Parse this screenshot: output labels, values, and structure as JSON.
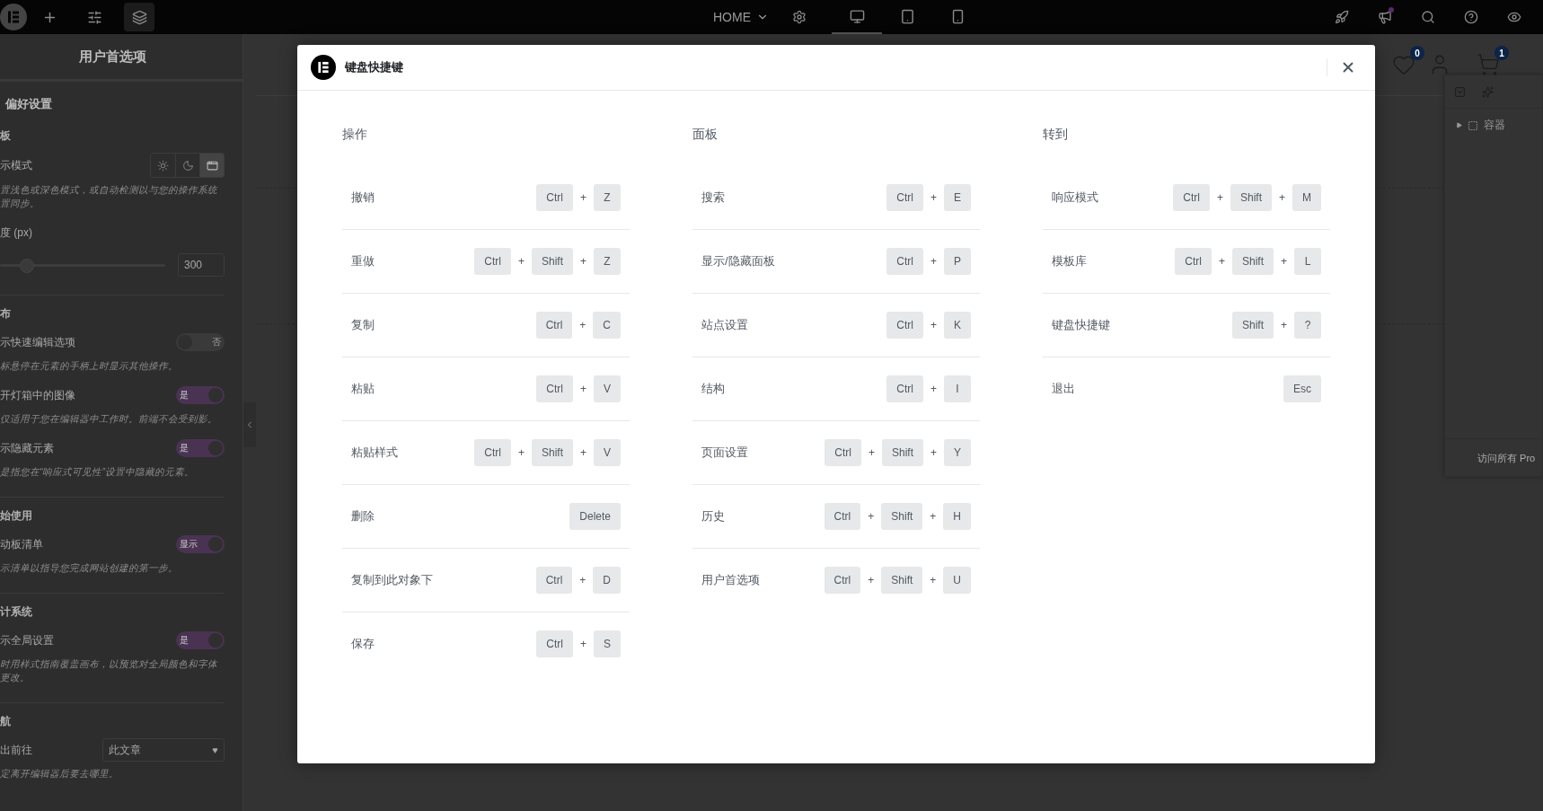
{
  "top_bar": {
    "tools": [
      {
        "kind": "add",
        "selected": false
      },
      {
        "kind": "settings",
        "selected": false
      },
      {
        "kind": "layers",
        "selected": true
      }
    ],
    "page_menu": "HOME",
    "devices": [
      {
        "kind": "desktop",
        "selected": true
      },
      {
        "kind": "tablet",
        "selected": false
      },
      {
        "kind": "mobile",
        "selected": false
      }
    ],
    "notification_dot": true
  },
  "preferences_panel": {
    "title": "用户首选项",
    "heading": "偏好设置",
    "sections": [
      {
        "title": "板",
        "items": [
          {
            "kind": "modes",
            "label": "示模式",
            "options": [
              {
                "kind": "light",
                "selected": false
              },
              {
                "kind": "dark",
                "selected": false
              },
              {
                "kind": "auto",
                "selected": true
              }
            ],
            "description": "置浅色或深色模式，或自动检测以与您的操作系统置同步。"
          },
          {
            "kind": "slider",
            "label": "度 (px)",
            "level": 0.16,
            "value": "300"
          }
        ]
      },
      {
        "title": "布",
        "items": [
          {
            "kind": "toggle",
            "label": "示快速编辑选项",
            "on": false,
            "state": "否",
            "description": "标悬停在元素的手柄上时显示其他操作。"
          },
          {
            "kind": "toggle",
            "label": "开灯箱中的图像",
            "on": true,
            "state": "是",
            "description": "仅适用于您在编辑器中工作时。前端不会受到影。"
          },
          {
            "kind": "toggle",
            "label": "示隐藏元素",
            "on": true,
            "state": "是",
            "description": "是指您在“响应式可见性”设置中隐藏的元素。"
          }
        ]
      },
      {
        "title": "始使用",
        "items": [
          {
            "kind": "toggle",
            "label": "动板清单",
            "on": true,
            "state": "显示",
            "description": "示清单以指导您完成网站创建的第一步。"
          }
        ]
      },
      {
        "title": "计系统",
        "items": [
          {
            "kind": "toggle",
            "label": "示全局设置",
            "on": true,
            "state": "是",
            "description": "时用样式指南覆盖画布，以预览对全局颜色和字体更改。"
          }
        ]
      },
      {
        "title": "航",
        "items": [
          {
            "kind": "select",
            "label": "出前往",
            "value": "此文章",
            "description": "定离开编辑器后要去哪里。"
          }
        ]
      }
    ]
  },
  "site_header": {
    "wishlist_count": "0",
    "cart_count": "1"
  },
  "navigator": {
    "items": [
      {
        "label": "容器",
        "expanded": false
      }
    ],
    "footer": "访问所有 Pro"
  },
  "modal": {
    "title": "键盘快捷键",
    "columns": [
      {
        "heading": "操作",
        "shortcuts": [
          {
            "label": "撤销",
            "keys": [
              "Ctrl",
              "+",
              "Z"
            ]
          },
          {
            "label": "重做",
            "keys": [
              "Ctrl",
              "+",
              "Shift",
              "+",
              "Z"
            ]
          },
          {
            "label": "复制",
            "keys": [
              "Ctrl",
              "+",
              "C"
            ]
          },
          {
            "label": "粘贴",
            "keys": [
              "Ctrl",
              "+",
              "V"
            ]
          },
          {
            "label": "粘贴样式",
            "keys": [
              "Ctrl",
              "+",
              "Shift",
              "+",
              "V"
            ]
          },
          {
            "label": "删除",
            "keys": [
              "Delete"
            ]
          },
          {
            "label": "复制到此对象下",
            "keys": [
              "Ctrl",
              "+",
              "D"
            ]
          },
          {
            "label": "保存",
            "keys": [
              "Ctrl",
              "+",
              "S"
            ]
          }
        ]
      },
      {
        "heading": "面板",
        "shortcuts": [
          {
            "label": "搜索",
            "keys": [
              "Ctrl",
              "+",
              "E"
            ]
          },
          {
            "label": "显示/隐藏面板",
            "keys": [
              "Ctrl",
              "+",
              "P"
            ]
          },
          {
            "label": "站点设置",
            "keys": [
              "Ctrl",
              "+",
              "K"
            ]
          },
          {
            "label": "结构",
            "keys": [
              "Ctrl",
              "+",
              "I"
            ]
          },
          {
            "label": "页面设置",
            "keys": [
              "Ctrl",
              "+",
              "Shift",
              "+",
              "Y"
            ]
          },
          {
            "label": "历史",
            "keys": [
              "Ctrl",
              "+",
              "Shift",
              "+",
              "H"
            ]
          },
          {
            "label": "用户首选项",
            "keys": [
              "Ctrl",
              "+",
              "Shift",
              "+",
              "U"
            ]
          }
        ]
      },
      {
        "heading": "转到",
        "shortcuts": [
          {
            "label": "响应模式",
            "keys": [
              "Ctrl",
              "+",
              "Shift",
              "+",
              "M"
            ]
          },
          {
            "label": "模板库",
            "keys": [
              "Ctrl",
              "+",
              "Shift",
              "+",
              "L"
            ]
          },
          {
            "label": "键盘快捷键",
            "keys": [
              "Shift",
              "+",
              "?"
            ]
          },
          {
            "label": "退出",
            "keys": [
              "Esc"
            ]
          }
        ]
      }
    ]
  }
}
